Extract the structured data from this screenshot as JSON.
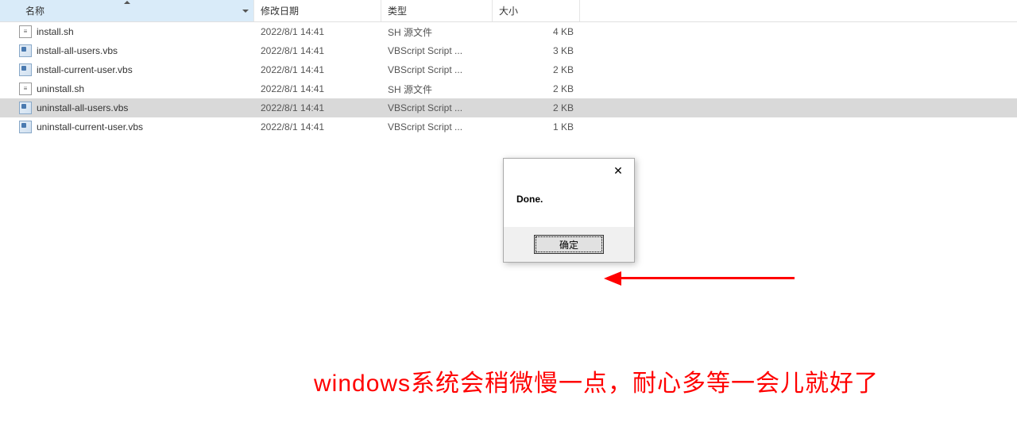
{
  "columns": {
    "name": "名称",
    "date": "修改日期",
    "type": "类型",
    "size": "大小"
  },
  "files": [
    {
      "name": "install.sh",
      "date": "2022/8/1 14:41",
      "type": "SH 源文件",
      "size": "4 KB",
      "icon": "sh",
      "selected": false
    },
    {
      "name": "install-all-users.vbs",
      "date": "2022/8/1 14:41",
      "type": "VBScript Script ...",
      "size": "3 KB",
      "icon": "vbs",
      "selected": false
    },
    {
      "name": "install-current-user.vbs",
      "date": "2022/8/1 14:41",
      "type": "VBScript Script ...",
      "size": "2 KB",
      "icon": "vbs",
      "selected": false
    },
    {
      "name": "uninstall.sh",
      "date": "2022/8/1 14:41",
      "type": "SH 源文件",
      "size": "2 KB",
      "icon": "sh",
      "selected": false
    },
    {
      "name": "uninstall-all-users.vbs",
      "date": "2022/8/1 14:41",
      "type": "VBScript Script ...",
      "size": "2 KB",
      "icon": "vbs",
      "selected": true
    },
    {
      "name": "uninstall-current-user.vbs",
      "date": "2022/8/1 14:41",
      "type": "VBScript Script ...",
      "size": "1 KB",
      "icon": "vbs",
      "selected": false
    }
  ],
  "dialog": {
    "message": "Done.",
    "ok_label": "确定"
  },
  "caption": "windows系统会稍微慢一点，耐心多等一会儿就好了"
}
